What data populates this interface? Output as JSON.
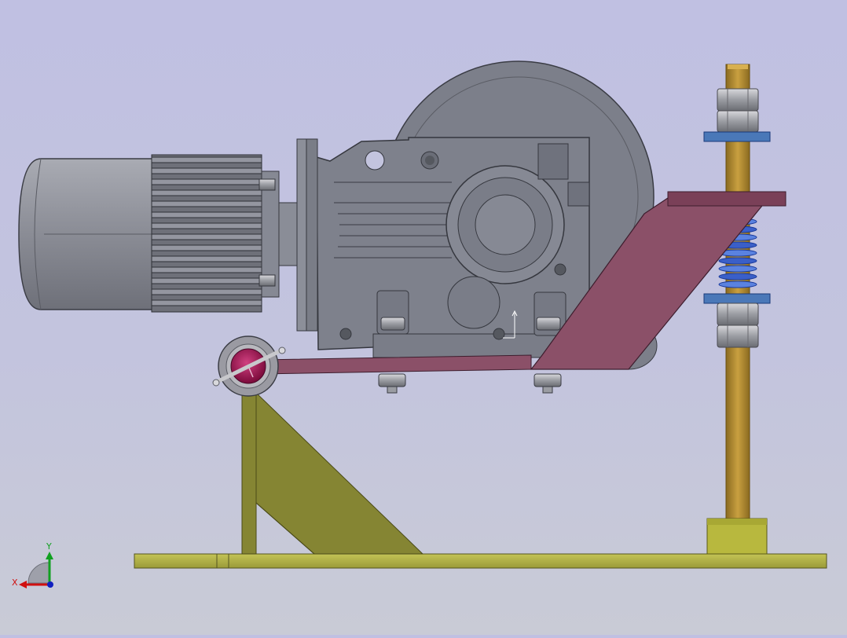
{
  "triad": {
    "x_label": "X",
    "y_label": "Y",
    "x_color": "#d01010",
    "y_color": "#10a020",
    "z_color": "#1020c0"
  },
  "colors": {
    "motor": "#8e9099",
    "gearbox": "#7c7f8a",
    "bracket": "#8b5068",
    "frame": "#858533",
    "base": "#b8b84a",
    "rod": "#b08a2c",
    "spring": "#3a5fc8",
    "washer": "#4a78b8",
    "pivot": "#b01a5a"
  }
}
